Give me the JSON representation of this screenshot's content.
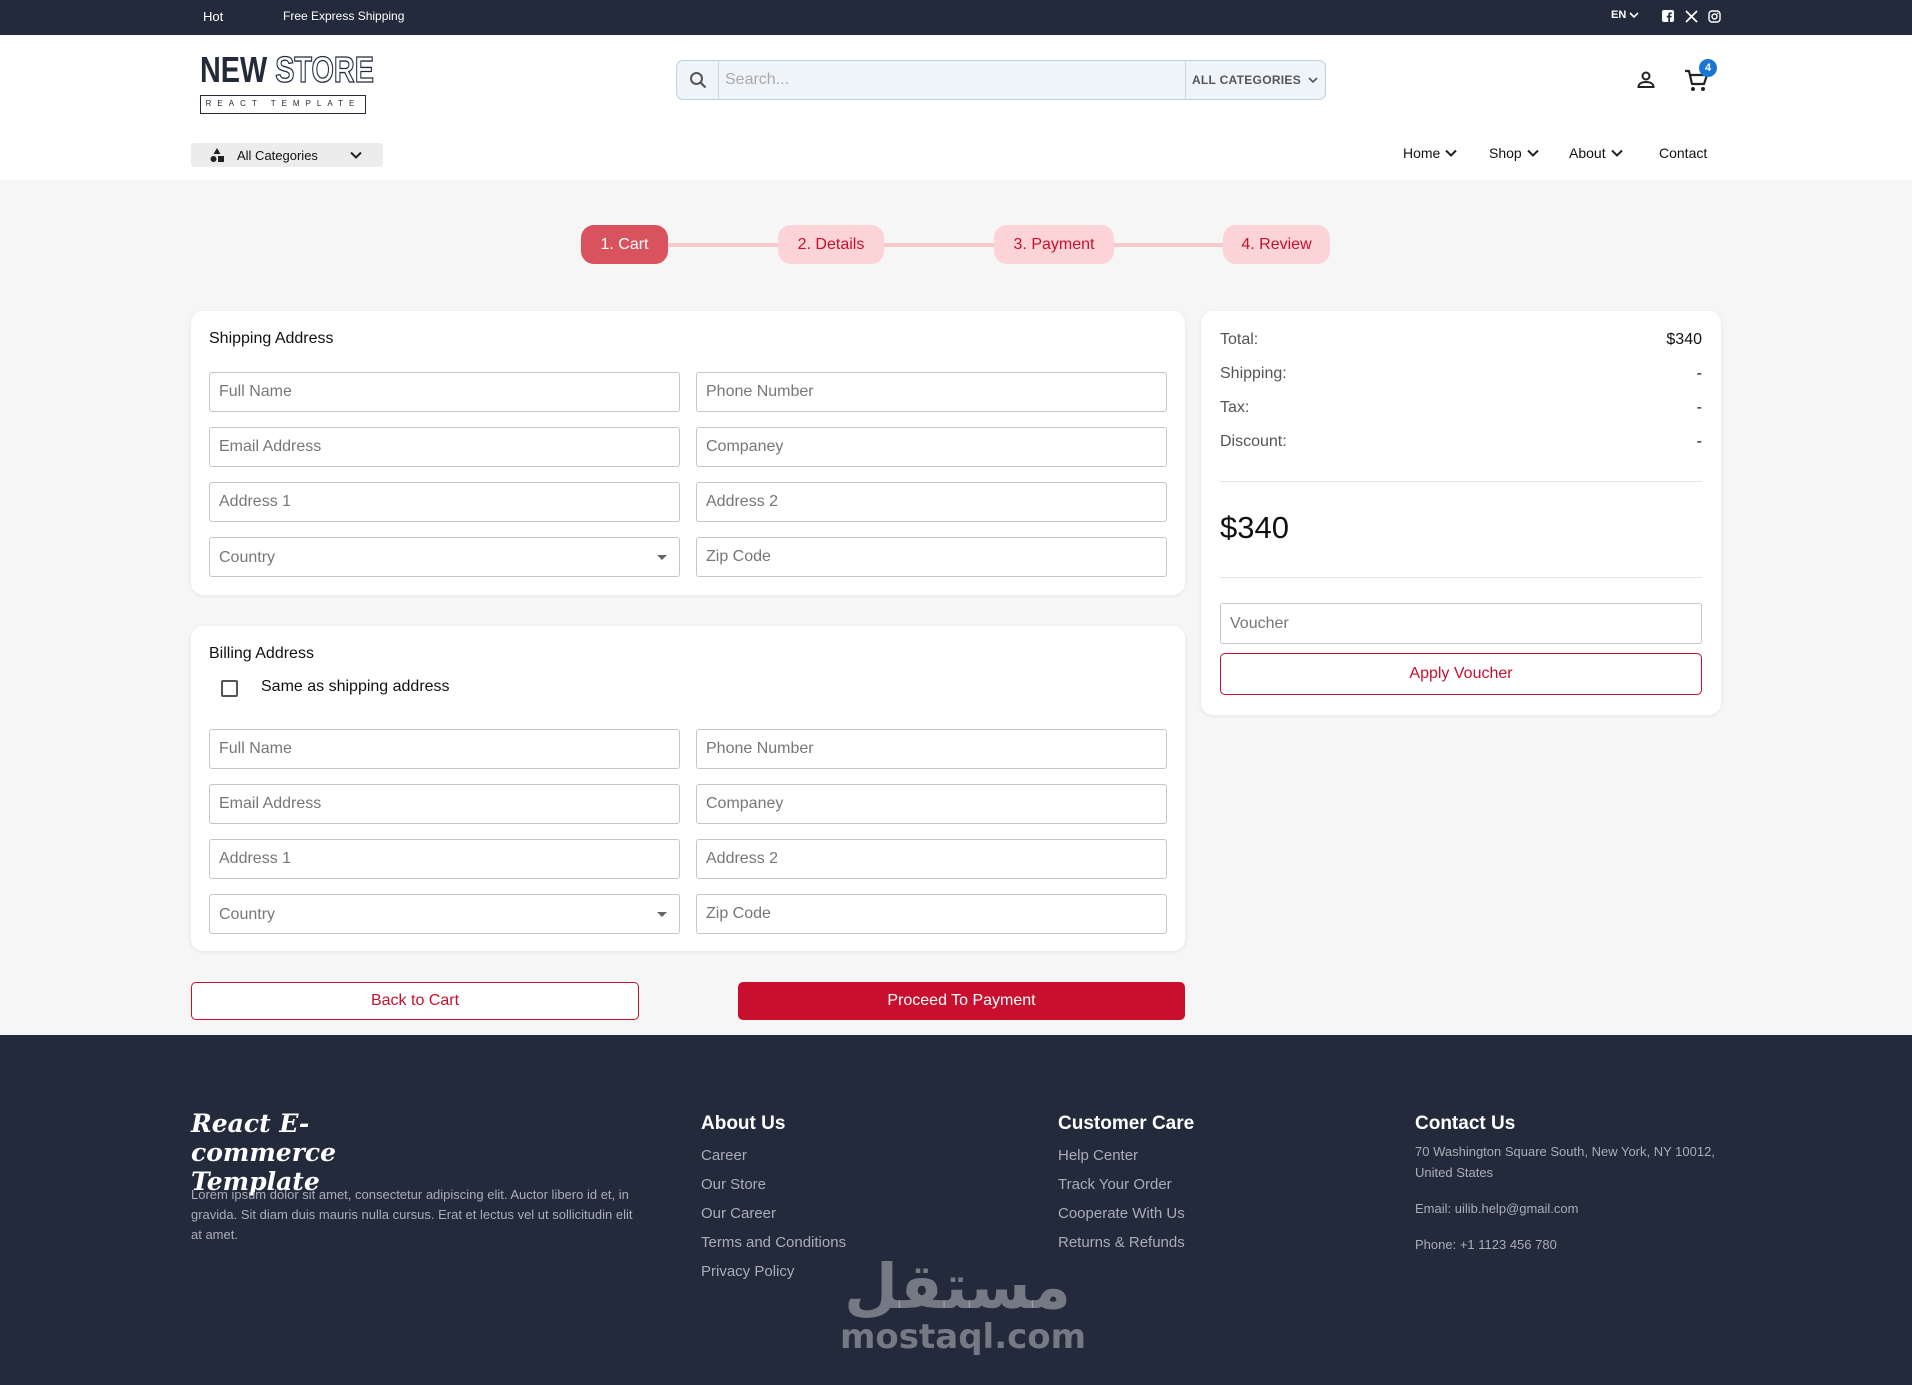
{
  "topbar": {
    "hot": "Hot",
    "promo": "Free Express Shipping",
    "language": "EN",
    "social": [
      "facebook-icon",
      "x-icon",
      "instagram-icon"
    ]
  },
  "header": {
    "logo_main_solid": "NEW",
    "logo_main_outline": "STORE",
    "logo_sub": "REACT TEMPLATE",
    "search_placeholder": "Search...",
    "search_category": "ALL CATEGORIES",
    "cart_count": "4",
    "all_categories": "All Categories",
    "nav": {
      "home": "Home",
      "shop": "Shop",
      "about": "About",
      "contact": "Contact"
    }
  },
  "stepper": {
    "steps": [
      "1. Cart",
      "2. Details",
      "3. Payment",
      "4. Review"
    ],
    "active_index": 0
  },
  "shipping": {
    "title": "Shipping Address",
    "full_name": "Full Name",
    "phone": "Phone Number",
    "email": "Email Address",
    "company": "Companey",
    "address1": "Address 1",
    "address2": "Address 2",
    "country": "Country",
    "zip": "Zip Code"
  },
  "billing": {
    "title": "Billing Address",
    "same_as_shipping": "Same as shipping address",
    "full_name": "Full Name",
    "phone": "Phone Number",
    "email": "Email Address",
    "company": "Companey",
    "address1": "Address 1",
    "address2": "Address 2",
    "country": "Country",
    "zip": "Zip Code"
  },
  "summary": {
    "total_label": "Total:",
    "total_value": "$340",
    "shipping_label": "Shipping:",
    "shipping_value": "-",
    "tax_label": "Tax:",
    "tax_value": "-",
    "discount_label": "Discount:",
    "discount_value": "-",
    "grand_total": "$340",
    "voucher_placeholder": "Voucher",
    "apply_voucher": "Apply Voucher"
  },
  "actions": {
    "back": "Back to Cart",
    "proceed": "Proceed To Payment"
  },
  "footer": {
    "brand_line1": "React E-commerce",
    "brand_line2": "Template",
    "description": "Lorem ipsum dolor sit amet, consectetur adipiscing elit. Auctor libero id et, in gravida. Sit diam duis mauris nulla cursus. Erat et lectus vel ut sollicitudin elit at amet.",
    "about_title": "About Us",
    "about_links": [
      "Career",
      "Our Store",
      "Our Career",
      "Terms and Conditions",
      "Privacy Policy"
    ],
    "care_title": "Customer Care",
    "care_links": [
      "Help Center",
      "Track Your Order",
      "Cooperate With Us",
      "Returns & Refunds"
    ],
    "contact_title": "Contact Us",
    "address": "70 Washington Square South, New York, NY 10012, United States",
    "email": "Email: uilib.help@gmail.com",
    "phone": "Phone: +1 1123 456 780"
  },
  "watermark": {
    "arabic": "مستقل",
    "latin": "mostaql.com"
  },
  "colors": {
    "dark": "#232a3b",
    "accent": "#c8102e",
    "step_active": "#d9535e",
    "step_inactive": "#fcd3d6",
    "badge": "#1976d2"
  }
}
